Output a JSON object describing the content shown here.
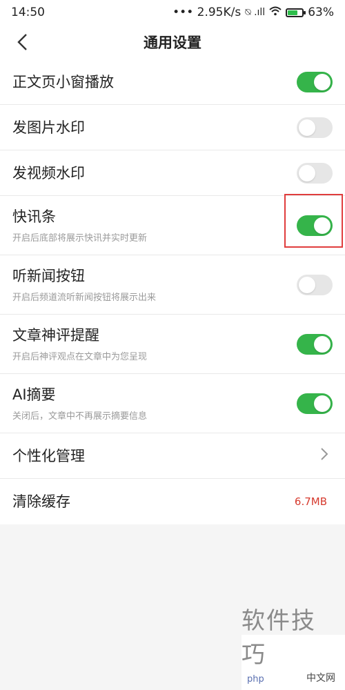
{
  "status_bar": {
    "time": "14:50",
    "network": "••• 2.95K/s",
    "signal_icons": "⍉ .ıll",
    "wifi_icon": "wifi-icon",
    "battery": "63%"
  },
  "nav": {
    "title": "通用设置",
    "back_icon": "chevron-left-icon"
  },
  "settings": [
    {
      "title": "正文页小窗播放",
      "subtitle": "",
      "toggle": "on"
    },
    {
      "title": "发图片水印",
      "subtitle": "",
      "toggle": "off"
    },
    {
      "title": "发视频水印",
      "subtitle": "",
      "toggle": "off"
    },
    {
      "title": "快讯条",
      "subtitle": "开启后底部将展示快讯并实时更新",
      "toggle": "on",
      "highlighted": true
    },
    {
      "title": "听新闻按钮",
      "subtitle": "开启后频道流听新闻按钮将展示出来",
      "toggle": "off"
    },
    {
      "title": "文章神评提醒",
      "subtitle": "开启后神评观点在文章中为您呈现",
      "toggle": "on"
    },
    {
      "title": "AI摘要",
      "subtitle": "关闭后，文章中不再展示摘要信息",
      "toggle": "on"
    }
  ],
  "personalization": {
    "title": "个性化管理",
    "icon": "chevron-right-icon"
  },
  "clear_cache": {
    "title": "清除缓存",
    "value": "6.7MB"
  },
  "watermark": {
    "text": "软件技巧",
    "site": "php",
    "site_cn": "中文网"
  },
  "colors": {
    "toggle_on": "#35b44a",
    "toggle_off": "#e6e6e6",
    "highlight": "#e03c3c",
    "cache_value": "#d63a2e"
  }
}
